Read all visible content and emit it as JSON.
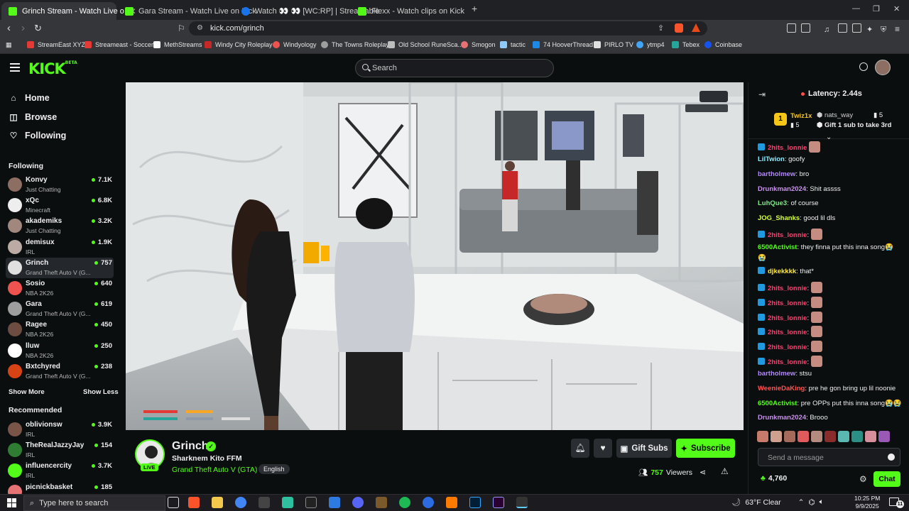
{
  "browser": {
    "tabs": [
      {
        "title": "Grinch Stream - Watch Live o",
        "active": true,
        "favicon_color": "#53fc18"
      },
      {
        "title": "Gara Stream - Watch Live on Kick",
        "active": false,
        "favicon_color": "#53fc18"
      },
      {
        "title": "Watch 👀 👀 [WC:RP] | Streamable",
        "active": false,
        "favicon_color": "#1a73e8"
      },
      {
        "title": "Flexx - Watch clips on Kick",
        "active": false,
        "favicon_color": "#53fc18"
      }
    ],
    "new_tab": "+",
    "url": "kick.com/grinch",
    "bookmarks": [
      {
        "label": "StreamEast XYZ",
        "color": "#e53935"
      },
      {
        "label": "Streameast - Soccer",
        "color": "#e53935"
      },
      {
        "label": "MethStreams",
        "color": "#ffffff"
      },
      {
        "label": "Windy City Roleplay",
        "color": "#c62828"
      },
      {
        "label": "Windyology",
        "color": "#ef5350"
      },
      {
        "label": "The Towns Roleplay",
        "color": "#9e9e9e"
      },
      {
        "label": "Old School RuneSca...",
        "color": "#bdbdbd"
      },
      {
        "label": "Smogon",
        "color": "#e57373"
      },
      {
        "label": "tactic",
        "color": "#90caf9"
      },
      {
        "label": "74 HooverThread",
        "color": "#1e88e5"
      },
      {
        "label": "PIRLO TV",
        "color": "#e0e0e0"
      },
      {
        "label": "ytmp4",
        "color": "#42a5f5"
      },
      {
        "label": "Tebex",
        "color": "#26a69a"
      },
      {
        "label": "Coinbase",
        "color": "#1652f0"
      }
    ]
  },
  "header": {
    "logo": "KICK",
    "logo_tm": "BETA",
    "search_placeholder": "Search"
  },
  "sidebar": {
    "nav": [
      {
        "label": "Home",
        "icon": "home-icon"
      },
      {
        "label": "Browse",
        "icon": "compass-icon"
      },
      {
        "label": "Following",
        "icon": "heart-icon"
      }
    ],
    "following_title": "Following",
    "following": [
      {
        "name": "Konvy",
        "game": "Just Chatting",
        "viewers": "7.1K",
        "color": "#8d6e63"
      },
      {
        "name": "xQc",
        "game": "Minecraft",
        "viewers": "6.8K",
        "color": "#eeeeee"
      },
      {
        "name": "akademiks",
        "game": "Just Chatting",
        "viewers": "3.2K",
        "color": "#a1887f"
      },
      {
        "name": "demisux",
        "game": "IRL",
        "viewers": "1.9K",
        "color": "#bcaaa4"
      },
      {
        "name": "Grinch",
        "game": "Grand Theft Auto V (G...",
        "viewers": "757",
        "color": "#e0e0e0"
      },
      {
        "name": "Sosio",
        "game": "NBA 2K26",
        "viewers": "640",
        "color": "#ef5350"
      },
      {
        "name": "Gara",
        "game": "Grand Theft Auto V (G...",
        "viewers": "619",
        "color": "#9e9e9e"
      },
      {
        "name": "Ragee",
        "game": "NBA 2K26",
        "viewers": "450",
        "color": "#6d4c41"
      },
      {
        "name": "lluw",
        "game": "NBA 2K26",
        "viewers": "250",
        "color": "#ffffff"
      },
      {
        "name": "Bxtchyred",
        "game": "Grand Theft Auto V (G...",
        "viewers": "238",
        "color": "#d84315"
      }
    ],
    "show_more": "Show More",
    "show_less": "Show Less",
    "recommended_title": "Recommended",
    "recommended": [
      {
        "name": "oblivionsw",
        "game": "IRL",
        "viewers": "3.9K",
        "color": "#795548"
      },
      {
        "name": "TheRealJazzyJay",
        "game": "IRL",
        "viewers": "154",
        "color": "#2e7d32"
      },
      {
        "name": "influencercity",
        "game": "IRL",
        "viewers": "3.7K",
        "color": "#53fc18"
      },
      {
        "name": "picnickbasket",
        "game": "",
        "viewers": "185",
        "color": "#e57373"
      }
    ]
  },
  "stream": {
    "streamer": "Grinch",
    "live_label": "LIVE",
    "title": "Sharknem Kito FFM",
    "category": "Grand Theft Auto V (GTA)",
    "language": "English",
    "gift_label": "Gift Subs",
    "subscribe_label": "Subscribe",
    "viewers_count": "757",
    "viewers_label": "Viewers"
  },
  "chat": {
    "latency": "Latency: 2.44s",
    "leaderboard": {
      "rank1_name": "Twiz1x",
      "rank1_count": "5",
      "rank2_name": "nats_way",
      "rank2_count": "5",
      "cta": "Gift 1 sub to take 3rd"
    },
    "messages": [
      {
        "user": "2hits_lonnie",
        "text": "",
        "color": "#ff3d6e",
        "badge": true,
        "emote": true
      },
      {
        "user": "LilTwion",
        "text": ": goofy",
        "color": "#8be9fd",
        "badge": false,
        "emote": false
      },
      {
        "user": "bartholmew",
        "text": ": bro",
        "color": "#b388ff",
        "badge": false,
        "emote": false
      },
      {
        "user": "Drunkman2024",
        "text": ": Shit assss",
        "color": "#c792ea",
        "badge": false,
        "emote": false
      },
      {
        "user": "LuhQue3",
        "text": ": of course",
        "color": "#7ee787",
        "badge": false,
        "emote": false
      },
      {
        "user": "JOG_Shanks",
        "text": ": good lil dls",
        "color": "#d4ff3a",
        "badge": false,
        "emote": false
      },
      {
        "user": "2hits_lonnie",
        "text": ":",
        "color": "#ff3d6e",
        "badge": true,
        "emote": true
      },
      {
        "user": "6500Activist",
        "text": ": they finna put this inna song😭",
        "color": "#53fc18",
        "badge": false,
        "emote": false
      },
      {
        "user": "😭",
        "text": "",
        "color": "#efeff1",
        "badge": false,
        "emote": false
      },
      {
        "user": "djkekkkk",
        "text": ": that*",
        "color": "#ffeb3b",
        "badge": true,
        "emote": false
      },
      {
        "user": "2hits_lonnie",
        "text": ":",
        "color": "#ff3d6e",
        "badge": true,
        "emote": true
      },
      {
        "user": "2hits_lonnie",
        "text": ":",
        "color": "#ff3d6e",
        "badge": true,
        "emote": true
      },
      {
        "user": "2hits_lonnie",
        "text": ":",
        "color": "#ff3d6e",
        "badge": true,
        "emote": true
      },
      {
        "user": "2hits_lonnie",
        "text": ":",
        "color": "#ff3d6e",
        "badge": true,
        "emote": true
      },
      {
        "user": "2hits_lonnie",
        "text": ":",
        "color": "#ff3d6e",
        "badge": true,
        "emote": true
      },
      {
        "user": "2hits_lonnie",
        "text": ":",
        "color": "#ff3d6e",
        "badge": true,
        "emote": true
      },
      {
        "user": "bartholmew",
        "text": ": stsu",
        "color": "#b388ff",
        "badge": false,
        "emote": false
      },
      {
        "user": "WeenieDaKing",
        "text": ": pre he gon bring up lil noonie",
        "color": "#ff5252",
        "badge": false,
        "emote": false
      },
      {
        "user": "6500Activist",
        "text": ": pre OPPs put this inna song😭😭",
        "color": "#53fc18",
        "badge": false,
        "emote": false
      },
      {
        "user": "Drunkman2024",
        "text": ": Brooo",
        "color": "#c792ea",
        "badge": false,
        "emote": false
      }
    ],
    "input_placeholder": "Send a message",
    "points": "4,760",
    "chat_button": "Chat"
  },
  "taskbar": {
    "search_placeholder": "Type here to search",
    "weather": "63°F  Clear",
    "time": "10:25 PM",
    "date": "9/9/2025",
    "notification_count": "11"
  }
}
